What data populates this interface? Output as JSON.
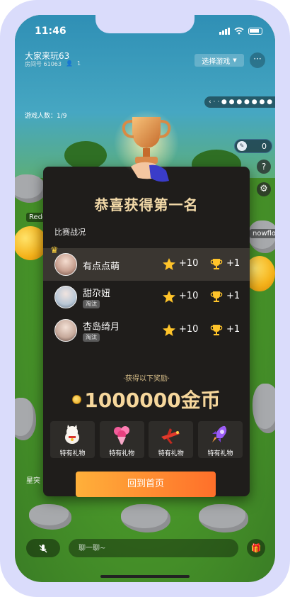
{
  "status_bar": {
    "time": "11:46"
  },
  "room": {
    "title": "大家来玩63",
    "room_no": "房间号 61063",
    "user_count": "1",
    "game_select_label": "选择游戏",
    "more_label": "···",
    "players_label": "游戏人数：1/9",
    "pen_count": "0",
    "side_name_left": "Redo",
    "side_name_right": "nowflo",
    "side_name_left2": "星突"
  },
  "result": {
    "title": "恭喜获得第一名",
    "section_label": "比赛战况",
    "players": [
      {
        "name": "有点点萌",
        "status": "",
        "points": "+10",
        "wins": "+1",
        "first": true
      },
      {
        "name": "甜尕妞",
        "status": "淘汰",
        "points": "+10",
        "wins": "+1",
        "first": false
      },
      {
        "name": "杏岛绮月",
        "status": "淘汰",
        "points": "+10",
        "wins": "+1",
        "first": false
      }
    ],
    "reward_label": "·获得以下奖励·",
    "coins": "1000000金币",
    "gifts": [
      {
        "label": "特有礼物",
        "icon": "lucky-cat-icon"
      },
      {
        "label": "特有礼物",
        "icon": "flower-bouquet-icon"
      },
      {
        "label": "特有礼物",
        "icon": "red-jet-icon"
      },
      {
        "label": "特有礼物",
        "icon": "purple-rocket-icon"
      }
    ],
    "home_button": "回到首页"
  },
  "bottom": {
    "chat_placeholder": "聊一聊~"
  },
  "colors": {
    "modal_bg": "#1f1d1b",
    "title_gold": "#f2d9a8",
    "button_gradient_start": "#ffb03a",
    "button_gradient_end": "#ff6f2a",
    "frame": "#dadcfb"
  }
}
